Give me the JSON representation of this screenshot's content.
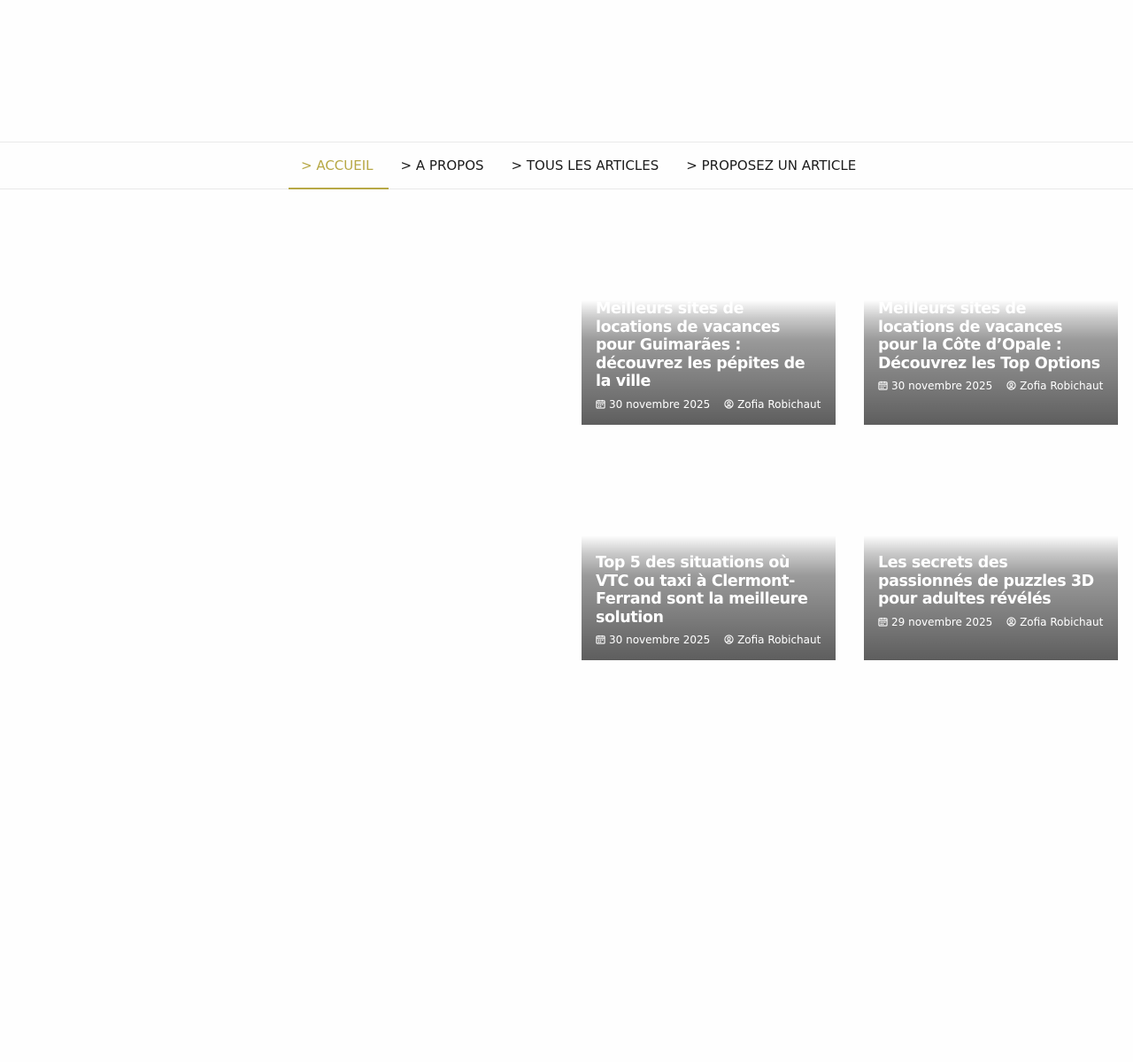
{
  "nav": {
    "items": [
      {
        "label": "> ACCUEIL"
      },
      {
        "label": "> A PROPOS"
      },
      {
        "label": "> TOUS LES ARTICLES"
      },
      {
        "label": "> PROPOSEZ UN ARTICLE"
      }
    ]
  },
  "articles": [
    {
      "title": "Meilleurs sites de locations de vacances pour Guimarães : découvrez les pépites de la ville",
      "date": "30 novembre 2025",
      "author": "Zofia Robichaut"
    },
    {
      "title": "Meilleurs sites de locations de vacances pour la Côte d’Opale : Découvrez les Top Options",
      "date": "30 novembre 2025",
      "author": "Zofia Robichaut"
    },
    {
      "title": "Top 5 des situations où VTC ou taxi à Clermont-Ferrand sont la meilleure solution",
      "date": "30 novembre 2025",
      "author": "Zofia Robichaut"
    },
    {
      "title": "Les secrets des passionnés de puzzles 3D pour adultes révélés",
      "date": "29 novembre 2025",
      "author": "Zofia Robichaut"
    }
  ],
  "colors": {
    "accent": "#b7a845",
    "nav_text": "#1b1b1b",
    "card_overlay": "#5e5e5e"
  },
  "icons": {
    "date": "calendar-icon",
    "author": "user-circle-icon"
  }
}
